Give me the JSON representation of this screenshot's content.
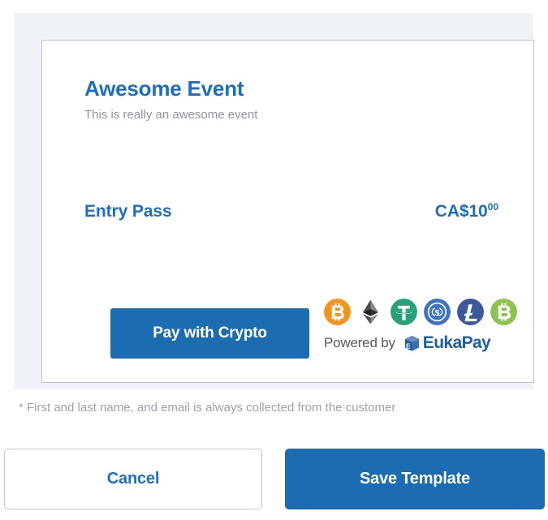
{
  "preview": {
    "event_title": "Awesome Event",
    "event_subtitle": "This is really an awesome event",
    "item_name": "Entry Pass",
    "price_main": "CA$10",
    "price_cents": "00",
    "pay_button_label": "Pay with Crypto",
    "powered_by_label": "Powered by",
    "provider_name": "EukaPay",
    "crypto_icons": [
      {
        "name": "bitcoin-icon",
        "symbol": "BTC",
        "color": "#f7931a"
      },
      {
        "name": "ethereum-icon",
        "symbol": "ETH",
        "color": "#3c3c3d"
      },
      {
        "name": "tether-icon",
        "symbol": "USDT",
        "color": "#26a17b"
      },
      {
        "name": "usd-coin-icon",
        "symbol": "USDC",
        "color": "#3e73c4"
      },
      {
        "name": "litecoin-icon",
        "symbol": "LTC",
        "color": "#3a5a9b"
      },
      {
        "name": "bitcoin-cash-icon",
        "symbol": "BCH",
        "color": "#8dc351"
      }
    ]
  },
  "footnote": "* First and last name, and email is always collected from the customer",
  "footer": {
    "cancel_label": "Cancel",
    "save_label": "Save Template"
  },
  "colors": {
    "brand_blue": "#1a6fc4",
    "button_blue": "#1b6cb0",
    "panel_bg": "#eff2f7",
    "muted_text": "#8d96a3",
    "card_border": "#b9c4d0"
  }
}
